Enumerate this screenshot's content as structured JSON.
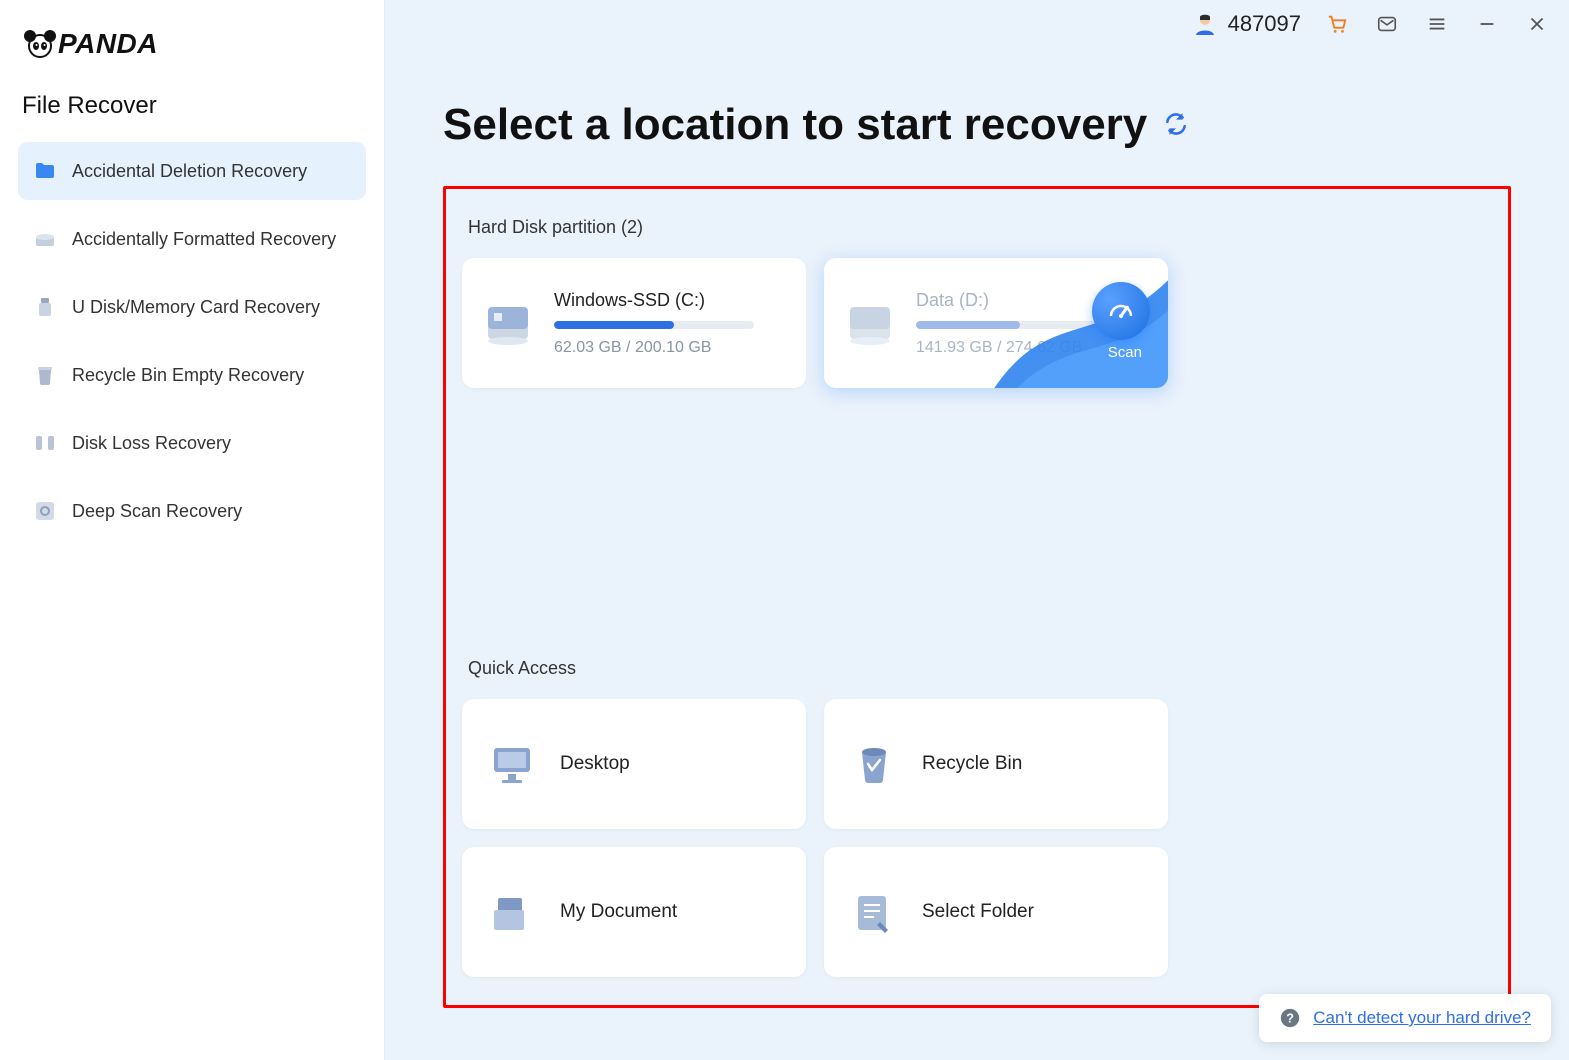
{
  "brand": "PANDA",
  "sidebar": {
    "title": "File Recover",
    "items": [
      {
        "label": "Accidental Deletion Recovery",
        "active": true
      },
      {
        "label": "Accidentally Formatted Recovery",
        "active": false
      },
      {
        "label": "U Disk/Memory Card Recovery",
        "active": false
      },
      {
        "label": "Recycle Bin Empty Recovery",
        "active": false
      },
      {
        "label": "Disk Loss Recovery",
        "active": false
      },
      {
        "label": "Deep Scan Recovery",
        "active": false
      }
    ]
  },
  "titlebar": {
    "user_id": "487097"
  },
  "main": {
    "page_title": "Select a location to start recovery",
    "partition_section_label": "Hard Disk partition   (2)",
    "partitions": [
      {
        "name": "Windows-SSD   (C:)",
        "usage": "62.03 GB / 200.10 GB",
        "fill_pct": 60,
        "hover": false
      },
      {
        "name": "Data   (D:)",
        "usage": "141.93 GB / 274.62 GB",
        "fill_pct": 52,
        "hover": true
      }
    ],
    "scan_label": "Scan",
    "quick_section_label": "Quick Access",
    "quick": [
      {
        "label": "Desktop"
      },
      {
        "label": "Recycle Bin"
      },
      {
        "label": "My Document"
      },
      {
        "label": "Select Folder"
      }
    ]
  },
  "help_link": "Can't detect your hard drive?"
}
